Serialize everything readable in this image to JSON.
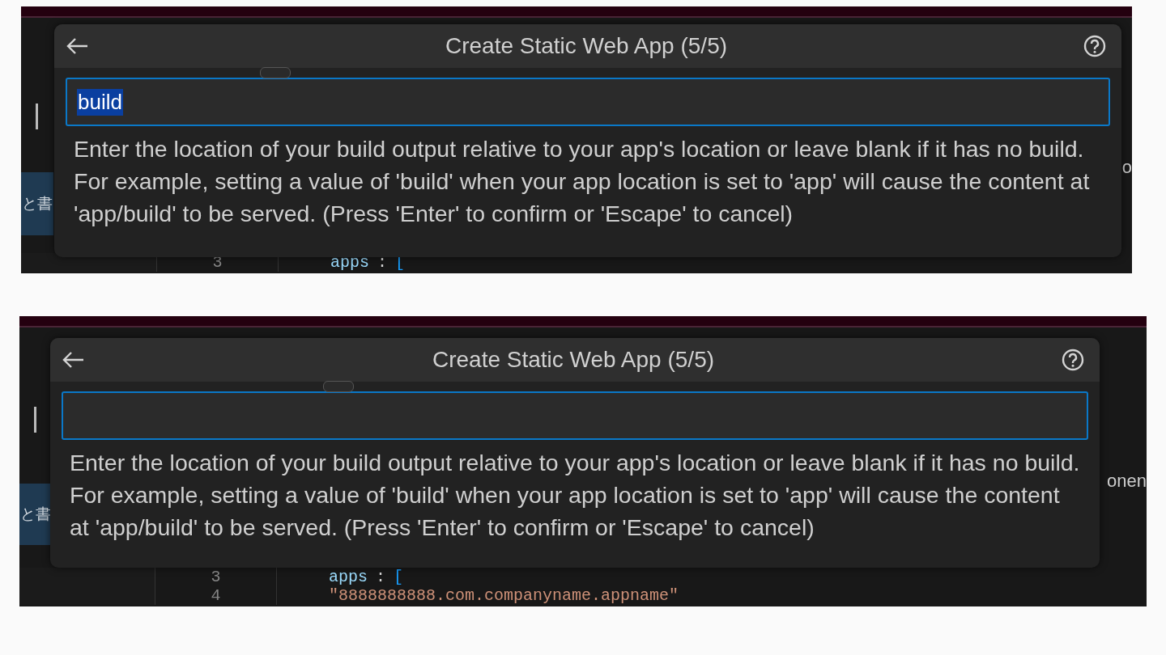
{
  "panels": [
    {
      "title": "Create Static Web App (5/5)",
      "input": {
        "value": "build",
        "selected": true
      },
      "description": "Enter the location of your build output relative to your app's location or leave blank if it has no build. For example, setting a value of 'build' when your app location is set to 'app' will cause the content at 'app/build' to be served. (Press 'Enter' to confirm or 'Escape' to cancel)",
      "left_label": "と書",
      "right_label": "o",
      "code_lines": [
        {
          "number": "3",
          "tokens": [
            {
              "text": "apps",
              "kind": "key"
            },
            {
              "text": ":",
              "kind": "punct"
            },
            {
              "text": "[",
              "kind": "bracket"
            }
          ]
        }
      ]
    },
    {
      "title": "Create Static Web App (5/5)",
      "description": "Enter the location of your build output relative to your app's location or leave blank if it has no build. For example, setting a value of 'build' when your app location is set to 'app' will cause the content at 'app/build' to be served. (Press 'Enter' to confirm or 'Escape' to cancel)",
      "left_label": "と書",
      "right_label": "onen",
      "code_lines": [
        {
          "number": "3",
          "tokens": [
            {
              "text": "apps",
              "kind": "key"
            },
            {
              "text": ":",
              "kind": "punct"
            },
            {
              "text": "[",
              "kind": "bracket"
            }
          ]
        },
        {
          "number": "4",
          "tokens": [
            {
              "text": "\"8888888888.com.companyname.appname\"",
              "kind": "string"
            }
          ]
        }
      ]
    }
  ]
}
